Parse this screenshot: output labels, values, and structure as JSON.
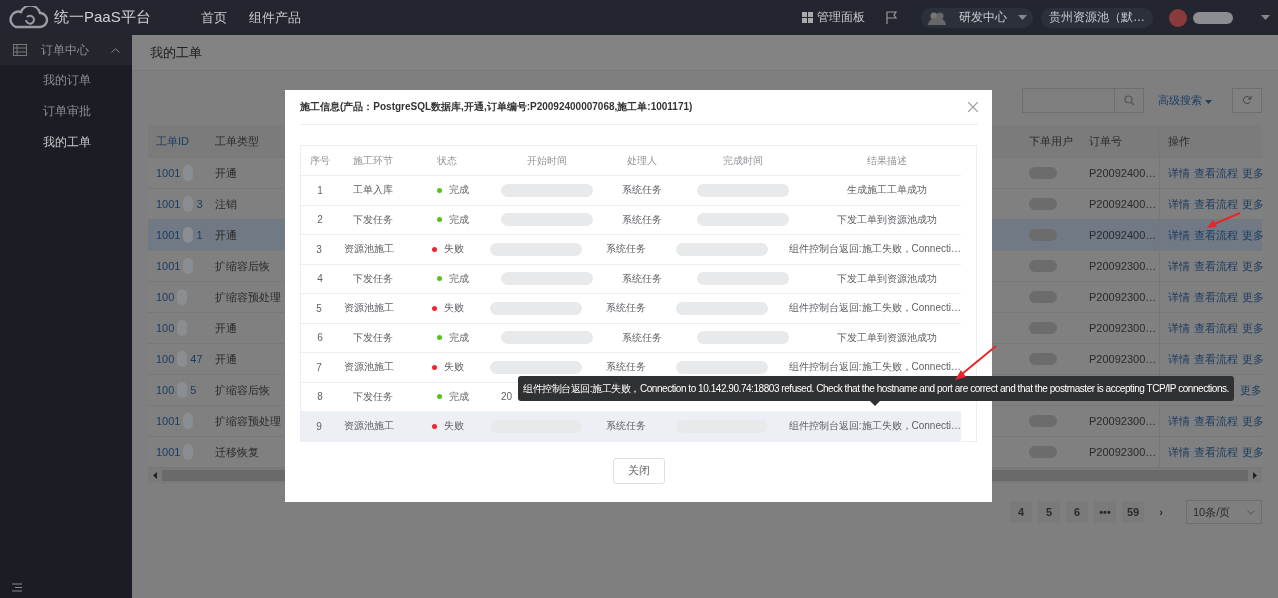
{
  "header": {
    "logo_text": "统一PaaS平台",
    "nav": [
      "首页",
      "组件产品"
    ],
    "dashboard": "管理面板",
    "org": "研发中心",
    "pool": "贵州资源池（默…"
  },
  "sidebar": {
    "group": {
      "label": "订单中心",
      "expanded": true,
      "items": [
        {
          "label": "我的订单",
          "selected": false
        },
        {
          "label": "订单审批",
          "selected": false
        },
        {
          "label": "我的工单",
          "selected": true
        }
      ]
    }
  },
  "page_title": "我的工单",
  "advanced_search": "高级搜索",
  "table": {
    "columns": [
      "工单ID",
      "工单类型",
      "下单用户",
      "订单号",
      "操作"
    ],
    "rows": [
      {
        "id": "1001",
        "type": "开通",
        "order_no": "P20092400…",
        "actions": [
          "详情",
          "查看流程",
          "更多"
        ],
        "selected": false
      },
      {
        "id": "1001",
        "id_tail": "3",
        "type": "注销",
        "order_no": "P20092400…",
        "actions": [
          "详情",
          "查看流程",
          "更多"
        ],
        "selected": false
      },
      {
        "id": "1001",
        "id_tail": "1",
        "type": "开通",
        "order_no": "P20092400…",
        "actions": [
          "详情",
          "查看流程",
          "更多"
        ],
        "selected": true
      },
      {
        "id": "1001",
        "type": "扩缩容后恢",
        "order_no": "P20092300…",
        "actions": [
          "详情",
          "查看流程",
          "更多"
        ],
        "selected": false
      },
      {
        "id": "100",
        "type": "扩缩容预处理",
        "order_no": "P20092300…",
        "actions": [
          "详情",
          "查看流程",
          "更多"
        ],
        "selected": false
      },
      {
        "id": "100",
        "type": "开通",
        "order_no": "P20092300…",
        "actions": [
          "详情",
          "查看流程",
          "更多"
        ],
        "selected": false
      },
      {
        "id": "100",
        "id_tail": "47",
        "type": "开通",
        "order_no": "P20092300…",
        "actions": [
          "详情",
          "查看流程",
          "更多"
        ],
        "selected": false
      },
      {
        "id": "100",
        "id_tail": "5",
        "type": "扩缩容后恢",
        "actions": [
          "更多"
        ],
        "selected": false
      },
      {
        "id": "1001",
        "type": "扩缩容预处理",
        "order_no": "P20092300…",
        "actions": [
          "详情",
          "查看流程",
          "更多"
        ],
        "selected": false
      },
      {
        "id": "1001",
        "type": "迁移恢复",
        "order_no": "P20092300…",
        "actions": [
          "详情",
          "查看流程",
          "更多"
        ],
        "selected": false
      }
    ]
  },
  "pagination": {
    "pages": [
      "4",
      "5",
      "6",
      "•••",
      "59"
    ],
    "next": "›",
    "page_size": "10条/页"
  },
  "modal": {
    "title": "施工信息(产品：PostgreSQL数据库,开通,订单编号:P20092400007068,施工单:1001171)",
    "columns": [
      "序号",
      "施工环节",
      "状态",
      "开始时间",
      "处理人",
      "完成时间",
      "结果描述"
    ],
    "rows": [
      {
        "no": "1",
        "step": "工单入库",
        "status": "完成",
        "kind": "ok",
        "handler": "系统任务",
        "result": "生成施工工单成功",
        "hovered": false
      },
      {
        "no": "2",
        "step": "下发任务",
        "status": "完成",
        "kind": "ok",
        "handler": "系统任务",
        "result": "下发工单到资源池成功",
        "hovered": false
      },
      {
        "no": "3",
        "step": "资源池施工",
        "status": "失败",
        "kind": "fail",
        "handler": "系统任务",
        "result": "组件控制台返回:施工失败，Connecti…",
        "hovered": false
      },
      {
        "no": "4",
        "step": "下发任务",
        "status": "完成",
        "kind": "ok",
        "handler": "系统任务",
        "result": "下发工单到资源池成功",
        "hovered": false
      },
      {
        "no": "5",
        "step": "资源池施工",
        "status": "失败",
        "kind": "fail",
        "handler": "系统任务",
        "result": "组件控制台返回:施工失败，Connecti…",
        "hovered": false
      },
      {
        "no": "6",
        "step": "下发任务",
        "status": "完成",
        "kind": "ok",
        "handler": "系统任务",
        "result": "下发工单到资源池成功",
        "hovered": false
      },
      {
        "no": "7",
        "step": "资源池施工",
        "status": "失败",
        "kind": "fail",
        "handler": "系统任务",
        "result": "组件控制台返回:施工失败，Connecti…",
        "hovered": false
      },
      {
        "no": "8",
        "step": "下发任务",
        "status": "完成",
        "kind": "ok",
        "start_fragment": "20",
        "hovered": false
      },
      {
        "no": "9",
        "step": "资源池施工",
        "status": "失败",
        "kind": "fail",
        "handler": "系统任务",
        "result": "组件控制台返回:施工失败，Connecti…",
        "hovered": true
      }
    ],
    "close_button": "关闭"
  },
  "tooltip": "组件控制台返回:施工失败，Connection to 10.142.90.74:18803 refused. Check that the hostname and port are correct and that the postmaster is accepting TCP/IP connections."
}
